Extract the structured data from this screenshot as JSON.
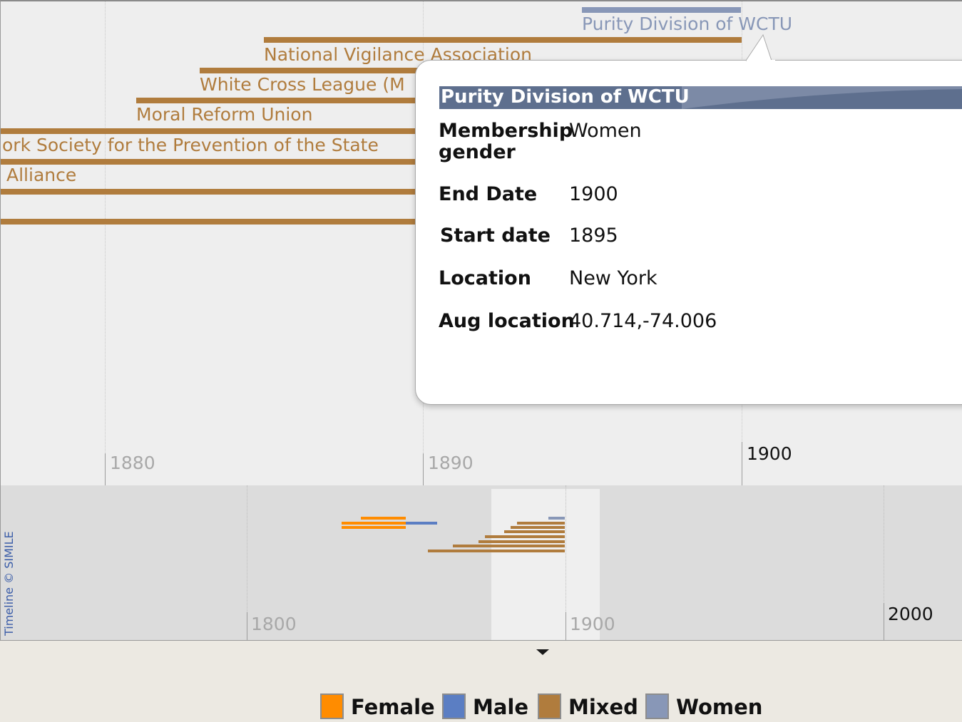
{
  "timeline": {
    "top_ticks": [
      {
        "label": "1880",
        "major": false
      },
      {
        "label": "1890",
        "major": false
      },
      {
        "label": "1900",
        "major": true
      }
    ],
    "bottom_ticks": [
      {
        "label": "1800",
        "major": false
      },
      {
        "label": "1900",
        "major": false
      },
      {
        "label": "2000",
        "major": true
      }
    ],
    "events": [
      {
        "label": "Purity Division of WCTU",
        "category": "Women"
      },
      {
        "label": "National Vigilance Association",
        "category": "Mixed"
      },
      {
        "label": "White Cross League (M",
        "category": "Mixed"
      },
      {
        "label": "Moral Reform Union",
        "category": "Mixed"
      },
      {
        "label": "ork Society for the Prevention of the State",
        "category": "Mixed"
      },
      {
        "label": "Alliance",
        "category": "Mixed"
      }
    ],
    "credit": "Timeline © SIMILE"
  },
  "popup": {
    "title": "Purity Division of WCTU",
    "fields": [
      {
        "key": "Membership gender",
        "key_line1": "Membership",
        "key_line2": "gender",
        "value": "Women"
      },
      {
        "key": "End Date",
        "value": "1900"
      },
      {
        "key": "Start date",
        "value": "1895"
      },
      {
        "key": "Location",
        "value": "New York"
      },
      {
        "key": "Aug location",
        "value": "40.714,-74.006"
      }
    ]
  },
  "legend": [
    {
      "label": "Female",
      "color": "#ff8c00"
    },
    {
      "label": "Male",
      "color": "#5b7ec3"
    },
    {
      "label": "Mixed",
      "color": "#b07c3d"
    },
    {
      "label": "Women",
      "color": "#8897b7"
    }
  ],
  "colors": {
    "mixed": "#b07c3d",
    "women": "#8897b7",
    "female": "#ff8c00",
    "male": "#5b7ec3",
    "popup_title_bg": "#5e6f8e"
  }
}
